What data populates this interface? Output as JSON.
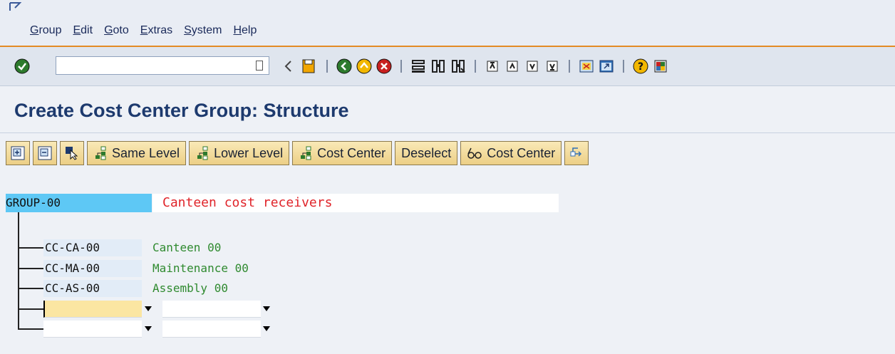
{
  "menu": {
    "items": [
      "Group",
      "Edit",
      "Goto",
      "Extras",
      "System",
      "Help"
    ]
  },
  "system_toolbar": {
    "command_field_value": "",
    "icons": [
      "enter-icon",
      "back-arrow-icon",
      "save-icon",
      "back-icon",
      "exit-icon",
      "cancel-icon",
      "print-icon",
      "find-icon",
      "find-next-icon",
      "first-page-icon",
      "previous-page-icon",
      "next-page-icon",
      "last-page-icon",
      "create-session-icon",
      "shortcut-icon",
      "help-icon",
      "customize-layout-icon"
    ]
  },
  "title": "Create Cost Center Group: Structure",
  "app_toolbar": {
    "same_level": "Same Level",
    "lower_level": "Lower Level",
    "cost_center": "Cost Center",
    "deselect": "Deselect",
    "cost_center_2": "Cost Center"
  },
  "tree": {
    "root": {
      "code": "GROUP-00",
      "description": "Canteen cost receivers"
    },
    "children": [
      {
        "code": "CC-CA-00",
        "description": "Canteen 00"
      },
      {
        "code": "CC-MA-00",
        "description": "Maintenance 00"
      },
      {
        "code": "CC-AS-00",
        "description": "Assembly 00"
      }
    ],
    "empty_rows": [
      {
        "code": "",
        "description": ""
      },
      {
        "code": "",
        "description": ""
      }
    ]
  },
  "colors": {
    "accent_line": "#e38b25",
    "root_highlight": "#5ec8f5",
    "root_description": "#e0242a",
    "child_description": "#2f8a2f",
    "button_bg": "#eccf86"
  }
}
